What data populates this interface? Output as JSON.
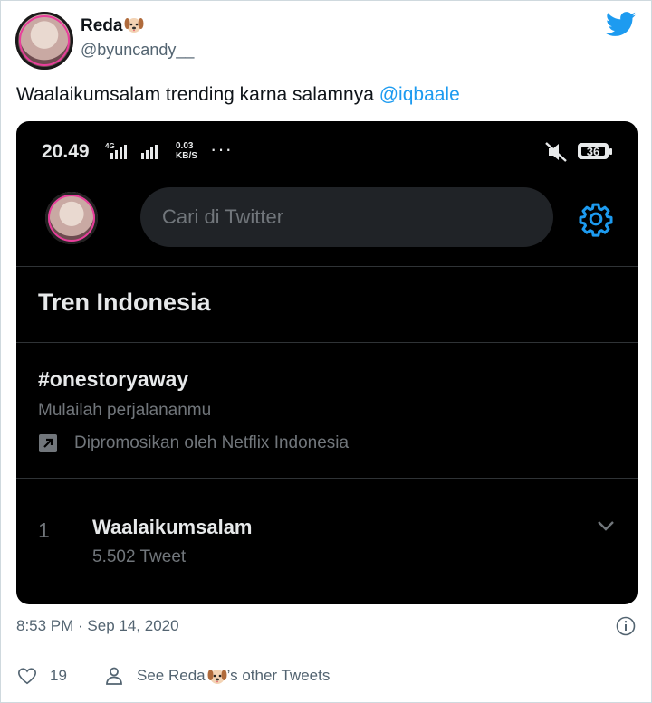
{
  "tweet": {
    "display_name": "Reda",
    "handle": "@byuncandy__",
    "text_before": "Waalaikumsalam trending karna salamnya ",
    "mention": "@iqbaale",
    "timestamp": "8:53 PM · Sep 14, 2020",
    "like_count": "19",
    "others_prefix": "See Reda",
    "others_suffix": "’s other Tweets",
    "brand_color": "#1d9bf0"
  },
  "screenshot": {
    "status_bar": {
      "time": "20.49",
      "network_top": "0.03",
      "network_bottom": "KB/S",
      "signal_label": "4G",
      "battery": "36"
    },
    "search": {
      "placeholder": "Cari di Twitter"
    },
    "section_title": "Tren Indonesia",
    "promoted": {
      "hashtag": "#onestoryaway",
      "description": "Mulailah perjalananmu",
      "promoted_by": "Dipromosikan oleh Netflix Indonesia"
    },
    "trend": {
      "rank": "1",
      "name": "Waalaikumsalam",
      "count": "5.502 Tweet"
    },
    "icons": [
      "settings-gear-icon",
      "promoted-arrow-icon",
      "chevron-down-icon",
      "mute-icon"
    ]
  }
}
